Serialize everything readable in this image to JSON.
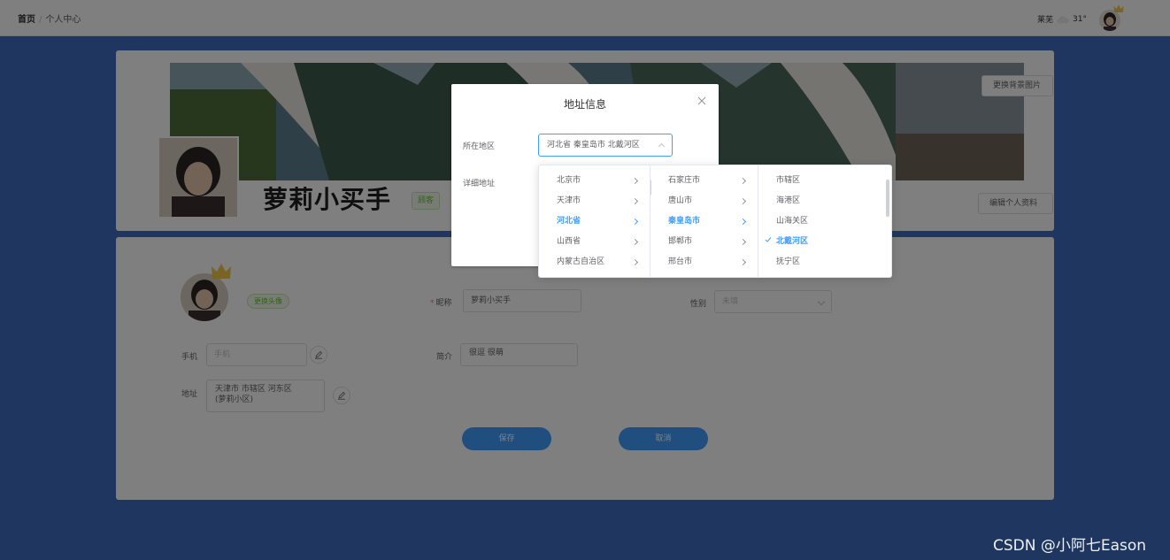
{
  "header": {
    "breadcrumb_home": "首页",
    "breadcrumb_sep": "/",
    "breadcrumb_current": "个人中心",
    "city": "莱芜",
    "temperature": "31°"
  },
  "profile_card": {
    "nickname": "萝莉小买手",
    "role_tag": "顾客",
    "change_banner_label": "更换背景图片",
    "edit_profile_label": "编辑个人资料"
  },
  "form": {
    "change_avatar_label": "更换头像",
    "nickname_label": "昵称",
    "nickname_value": "萝莉小买手",
    "gender_label": "性别",
    "gender_placeholder": "未填",
    "phone_label": "手机",
    "phone_placeholder": "手机",
    "intro_label": "简介",
    "intro_value": "很逗  很萌",
    "address_label": "地址",
    "address_value": "天津市 市辖区 河东区\n(萝莉小区)",
    "save_label": "保存",
    "cancel_label": "取消"
  },
  "dialog": {
    "title": "地址信息",
    "region_label": "所在地区",
    "region_value": "河北省 秦皇岛市 北戴河区",
    "detail_label": "详细地址"
  },
  "cascader": {
    "provinces": [
      {
        "label": "北京市",
        "active": false
      },
      {
        "label": "天津市",
        "active": false
      },
      {
        "label": "河北省",
        "active": true
      },
      {
        "label": "山西省",
        "active": false
      },
      {
        "label": "内蒙古自治区",
        "active": false
      }
    ],
    "cities": [
      {
        "label": "石家庄市",
        "active": false
      },
      {
        "label": "唐山市",
        "active": false
      },
      {
        "label": "秦皇岛市",
        "active": true
      },
      {
        "label": "邯郸市",
        "active": false
      },
      {
        "label": "邢台市",
        "active": false
      }
    ],
    "districts": [
      {
        "label": "市辖区",
        "active": false
      },
      {
        "label": "海港区",
        "active": false
      },
      {
        "label": "山海关区",
        "active": false
      },
      {
        "label": "北戴河区",
        "active": true
      },
      {
        "label": "抚宁区",
        "active": false
      }
    ]
  },
  "watermark": "CSDN @小阿七Eason",
  "colors": {
    "primary": "#409eff",
    "page_background": "#3f6fc1",
    "success": "#67c23a"
  }
}
